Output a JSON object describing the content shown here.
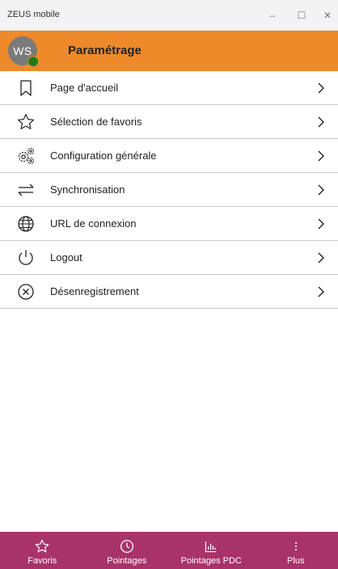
{
  "window": {
    "title": "ZEUS mobile",
    "controls": {
      "minimize": "–",
      "maximize": "☐",
      "close": "✕"
    }
  },
  "header": {
    "avatar_initials": "WS",
    "title": "Paramétrage",
    "accent_color": "#ef8a2a",
    "presence_color": "#1e7b1e"
  },
  "menu": {
    "items": [
      {
        "label": "Page d'accueil",
        "icon": "bookmark-icon"
      },
      {
        "label": "Sélection de favoris",
        "icon": "star-icon"
      },
      {
        "label": "Configuration générale",
        "icon": "gears-icon"
      },
      {
        "label": "Synchronisation",
        "icon": "sync-arrows-icon"
      },
      {
        "label": "URL de connexion",
        "icon": "globe-icon"
      },
      {
        "label": "Logout",
        "icon": "power-icon"
      },
      {
        "label": "Désenregistrement",
        "icon": "cancel-circle-icon"
      }
    ]
  },
  "bottom_nav": {
    "background_color": "#a8336a",
    "tabs": [
      {
        "label": "Favoris",
        "icon": "star-icon"
      },
      {
        "label": "Pointages",
        "icon": "clock-icon"
      },
      {
        "label": "Pointages PDC",
        "icon": "bar-chart-icon"
      },
      {
        "label": "Plus",
        "icon": "more-vertical-icon"
      }
    ]
  }
}
